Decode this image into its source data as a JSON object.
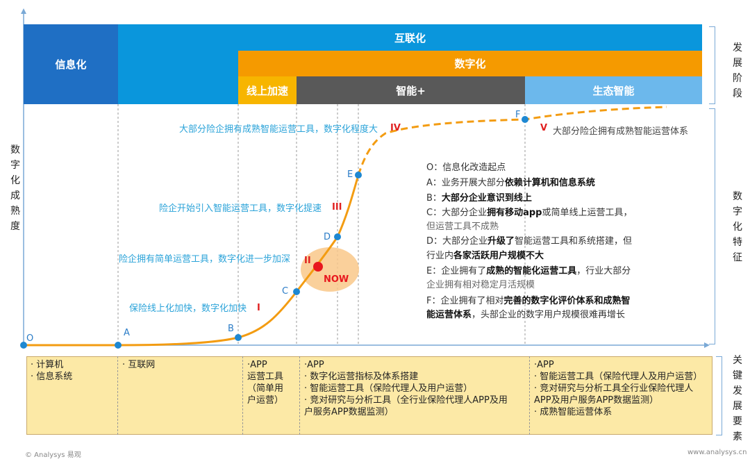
{
  "stages": {
    "xinxihua": "信息化",
    "hulianhua": "互联化",
    "shuzihua": "数字化",
    "xianshang": "线上加速",
    "zhineng": "智能+",
    "shengtai": "生态智能"
  },
  "right_labels": {
    "stage": "发展阶段",
    "feature": "数字化特征",
    "factors": "关键发展要素"
  },
  "y_label": "数字化成熟度",
  "points": {
    "O": "O",
    "A": "A",
    "B": "B",
    "C": "C",
    "D": "D",
    "E": "E",
    "F": "F"
  },
  "now_label": "NOW",
  "notes": {
    "n1": "保险线上化加快，数字化加快",
    "n2": "险企拥有简单运营工具，数字化进一步加深",
    "n3": "险企开始引入智能运营工具，数字化提速",
    "n4": "大部分险企拥有成熟智能运营工具，数字化程度大",
    "n5": "大部分险企拥有成熟智能运营体系"
  },
  "romans": {
    "r1": "I",
    "r2": "II",
    "r3": "III",
    "r4": "IV",
    "r5": "V"
  },
  "legend": {
    "o": "O：信息化改造起点",
    "a_pre": "A：业务开展大部分",
    "a_bold": "依赖计算机和信息系统",
    "b_pre": "B：",
    "b_bold": "大部分企业意识到线上",
    "c_pre": "C：大部分企业",
    "c_bold": "拥有移动app",
    "c_post": "或简单线上运营工具，",
    "c_line2": "但运营工具不成熟",
    "d_pre": "D：大部分企业",
    "d_bold": "升级了",
    "d_post": "智能运营工具和系统搭建，但",
    "d_line2_pre": "行业内",
    "d_line2_bold": "各家活跃用户规模不大",
    "e_pre": "E：企业拥有了",
    "e_bold": "成熟的智能化运营工具",
    "e_post": "，行业大部分",
    "e_line2": "企业拥有相对稳定月活规模",
    "f_pre": "F：企业拥有了相对",
    "f_bold": "完善的数字化评价体系和成熟智",
    "f_line2_bold": "能运营体系",
    "f_line2_post": "，头部企业的数字用户规模很难再增长"
  },
  "factors": {
    "c1": [
      "· 计算机",
      "· 信息系统"
    ],
    "c2": [
      "· 互联网"
    ],
    "c3": [
      "·APP",
      "  运营工具",
      "  （简单用",
      "  户运营）"
    ],
    "c4": [
      "·APP",
      "· 数字化运营指标及体系搭建",
      "· 智能运营工具（保险代理人及用户运营）",
      "· 竞对研究与分析工具（全行业保险代理人APP及用",
      "户服务APP数据监测）"
    ],
    "c5": [
      "·APP",
      "· 智能运营工具（保险代理人及用户运营）",
      "· 竞对研究与分析工具全行业保险代理人",
      "APP及用户服务APP数据监测）",
      "· 成熟智能运营体系"
    ]
  },
  "footer": {
    "left": "© Analysys 易观",
    "right": "www.analysys.cn"
  },
  "colors": {
    "blue_dark": "#1f6fc4",
    "blue": "#0a96dc",
    "orange": "#f59a00",
    "gold": "#f7b500",
    "gray": "#595959",
    "light_blue": "#6cb8ec",
    "curve": "#f39c12"
  }
}
